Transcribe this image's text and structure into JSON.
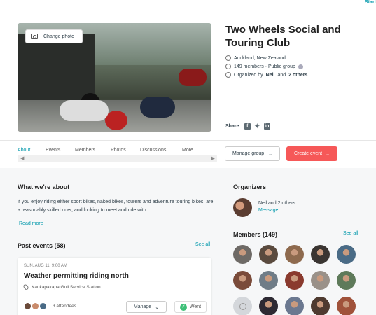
{
  "topbar": {
    "start_label": "Start"
  },
  "group": {
    "title": "Two Wheels Social and Touring Club",
    "change_photo_label": "Change photo",
    "location": "Auckland, New Zealand",
    "members_text": "149 members · Public group",
    "organized_prefix": "Organized by",
    "organizer_name": "Neil",
    "organizer_and": "and",
    "organizer_others": "2 others",
    "share_label": "Share:"
  },
  "tabs": [
    {
      "label": "About"
    },
    {
      "label": "Events"
    },
    {
      "label": "Members"
    },
    {
      "label": "Photos"
    },
    {
      "label": "Discussions"
    },
    {
      "label": "More"
    }
  ],
  "actions": {
    "manage_group_label": "Manage group",
    "create_event_label": "Create event"
  },
  "about": {
    "heading": "What we're about",
    "text": "If you enjoy riding either sport bikes, naked bikes, tourers and adventure touring bikes, are a reasonably skilled rider, and looking to meet and ride with",
    "read_more": "Read more"
  },
  "past_events": {
    "heading": "Past events (58)",
    "see_all": "See all",
    "event": {
      "date": "SUN, AUG 11, 9:00 AM",
      "title": "Weather permitting riding north",
      "location": "Kaukapakapa Gull Service Station",
      "attendees": "3 attendees",
      "manage_label": "Manage",
      "went_label": "Went"
    }
  },
  "organizers": {
    "heading": "Organizers",
    "name": "Neil",
    "and": "and",
    "others": "2 others",
    "message": "Message"
  },
  "members_section": {
    "heading": "Members (149)",
    "see_all": "See all",
    "avatar_colors": [
      "#6e6a66",
      "#5a4a3e",
      "#8e6a4e",
      "#3a3532",
      "#4a6b86",
      "#7a4b3a",
      "#6f7c87",
      "#8a3a2e",
      "#9a9189",
      "#5e7a5a",
      "#d4d7db",
      "#2e2a33",
      "#6b7890",
      "#4e3a30",
      "#a0523a"
    ]
  },
  "colors": {
    "accent": "#0098ab",
    "create": "#f65858",
    "went_check": "#3dbf77"
  }
}
